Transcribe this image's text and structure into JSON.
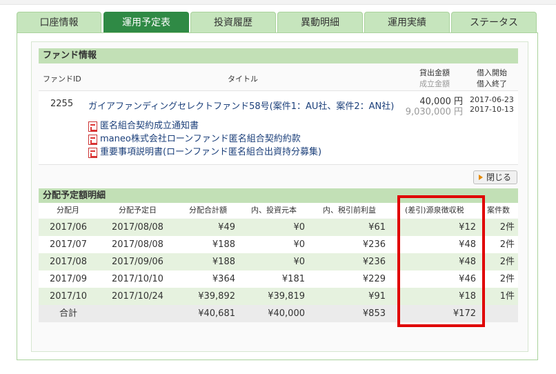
{
  "tabs": [
    "口座情報",
    "運用予定表",
    "投資履歴",
    "異動明細",
    "運用実績",
    "ステータス"
  ],
  "active_tab_index": 1,
  "fund_info": {
    "header": "ファンド情報",
    "col_id": "ファンドID",
    "col_title": "タイトル",
    "col_amount_a": "貸出金額",
    "col_amount_b": "成立金額",
    "col_date_a": "借入開始",
    "col_date_b": "借入終了",
    "id": "2255",
    "title": "ガイアファンディングセレクトファンド58号(案件1：AU社、案件2：AN社)",
    "loan_amount": "40,000 円",
    "established_amount": "9,030,000 円",
    "start_date": "2017-06-23",
    "end_date": "2017-10-13",
    "documents": [
      "匿名組合契約成立通知書",
      "maneo株式会社ローンファンド匿名組合契約約款",
      "重要事項説明書(ローンファンド匿名組合出資持分募集)"
    ]
  },
  "close_button": "閉じる",
  "distribution": {
    "header": "分配予定額明細",
    "columns": [
      "分配月",
      "分配予定日",
      "分配合計額",
      "内、投資元本",
      "内、税引前利益",
      "(差引)源泉徴収税",
      "案件数"
    ],
    "rows": [
      [
        "2017/06",
        "2017/08/08",
        "¥49",
        "¥0",
        "¥61",
        "¥12",
        "2件"
      ],
      [
        "2017/07",
        "2017/08/08",
        "¥188",
        "¥0",
        "¥236",
        "¥48",
        "2件"
      ],
      [
        "2017/08",
        "2017/09/06",
        "¥188",
        "¥0",
        "¥236",
        "¥48",
        "2件"
      ],
      [
        "2017/09",
        "2017/10/10",
        "¥364",
        "¥181",
        "¥229",
        "¥46",
        "2件"
      ],
      [
        "2017/10",
        "2017/10/24",
        "¥39,892",
        "¥39,819",
        "¥91",
        "¥18",
        "1件"
      ]
    ],
    "total": [
      "合計",
      "",
      "¥40,681",
      "¥40,000",
      "¥853",
      "¥172",
      ""
    ]
  },
  "colors": {
    "tab_active": "#2f8a45",
    "tab_inactive": "#c6e5bd",
    "section_header": "#c2e0b6",
    "row_alt": "#e6f2df",
    "highlight": "#e00000"
  }
}
